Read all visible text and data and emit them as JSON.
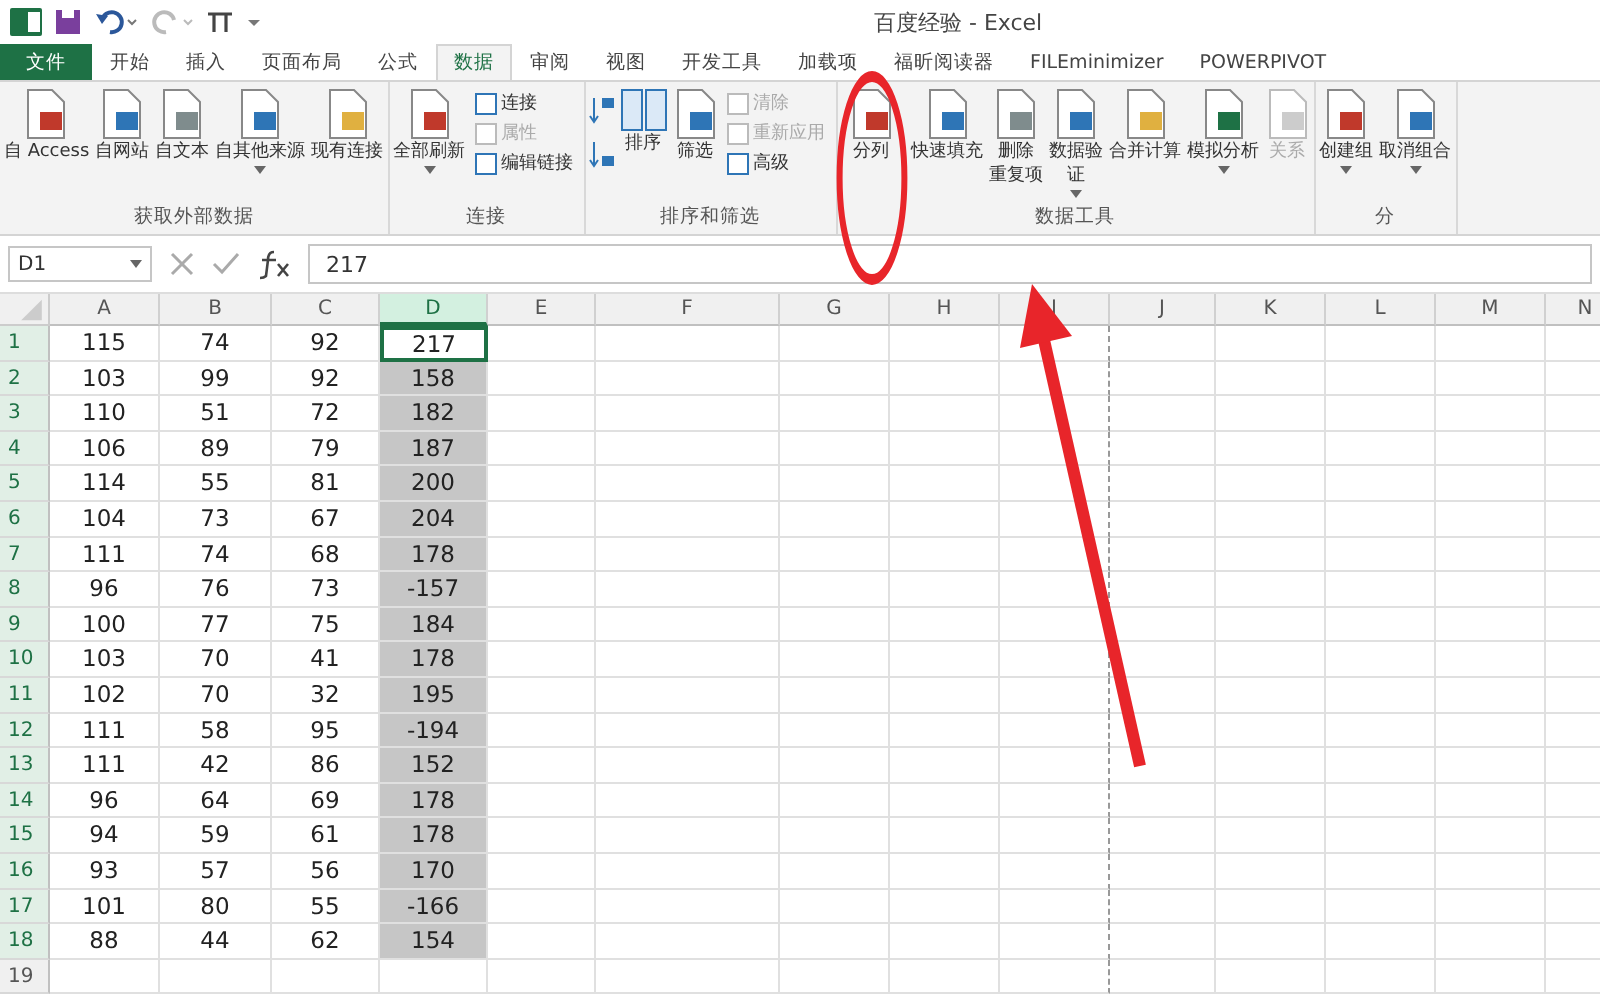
{
  "window": {
    "title": "百度经验 - Excel"
  },
  "tabs": [
    {
      "label": "文件",
      "kind": "file",
      "selected": false
    },
    {
      "label": "开始",
      "kind": "tab",
      "selected": false
    },
    {
      "label": "插入",
      "kind": "tab",
      "selected": false
    },
    {
      "label": "页面布局",
      "kind": "tab",
      "selected": false
    },
    {
      "label": "公式",
      "kind": "tab",
      "selected": false
    },
    {
      "label": "数据",
      "kind": "tab",
      "selected": true
    },
    {
      "label": "审阅",
      "kind": "tab",
      "selected": false
    },
    {
      "label": "视图",
      "kind": "tab",
      "selected": false
    },
    {
      "label": "开发工具",
      "kind": "tab",
      "selected": false
    },
    {
      "label": "加载项",
      "kind": "tab",
      "selected": false
    },
    {
      "label": "福昕阅读器",
      "kind": "tab",
      "selected": false
    },
    {
      "label": "FILEminimizer",
      "kind": "tab",
      "selected": false
    },
    {
      "label": "POWERPIVOT",
      "kind": "tab",
      "selected": false
    }
  ],
  "ribbon_groups": [
    {
      "label": "获取外部数据",
      "buttons": [
        {
          "label": "自 Access",
          "kind": "large",
          "disabled": false,
          "caret": false
        },
        {
          "label": "自网站",
          "kind": "large",
          "disabled": false,
          "caret": false
        },
        {
          "label": "自文本",
          "kind": "large",
          "disabled": false,
          "caret": false
        },
        {
          "label": "自其他来源",
          "kind": "large",
          "disabled": false,
          "caret": true
        },
        {
          "label": "现有连接",
          "kind": "large",
          "disabled": false,
          "caret": false
        }
      ]
    },
    {
      "label": "连接",
      "buttons": [
        {
          "label": "全部刷新",
          "kind": "large",
          "disabled": false,
          "caret": true
        },
        {
          "label": "连接",
          "kind": "small",
          "disabled": false,
          "caret": false
        },
        {
          "label": "属性",
          "kind": "small",
          "disabled": true,
          "caret": false
        },
        {
          "label": "编辑链接",
          "kind": "small",
          "disabled": false,
          "caret": false
        }
      ]
    },
    {
      "label": "排序和筛选",
      "buttons": [
        {
          "label": "排序",
          "kind": "sort",
          "disabled": false,
          "caret": false
        },
        {
          "label": "筛选",
          "kind": "large",
          "disabled": false,
          "caret": false
        },
        {
          "label": "清除",
          "kind": "small",
          "disabled": true,
          "caret": false
        },
        {
          "label": "重新应用",
          "kind": "small",
          "disabled": true,
          "caret": false
        },
        {
          "label": "高级",
          "kind": "small",
          "disabled": false,
          "caret": false
        }
      ]
    },
    {
      "label": "数据工具",
      "buttons": [
        {
          "label": "分列",
          "kind": "large",
          "disabled": false,
          "caret": false,
          "circled": true
        },
        {
          "label": "快速填充",
          "kind": "large",
          "disabled": false,
          "caret": false
        },
        {
          "label": [
            "删除",
            "重复项"
          ],
          "kind": "large",
          "disabled": false,
          "caret": false
        },
        {
          "label": [
            "数据验",
            "证"
          ],
          "kind": "large",
          "disabled": false,
          "caret": true
        },
        {
          "label": "合并计算",
          "kind": "large",
          "disabled": false,
          "caret": false
        },
        {
          "label": "模拟分析",
          "kind": "large",
          "disabled": false,
          "caret": true
        },
        {
          "label": "关系",
          "kind": "large",
          "disabled": true,
          "caret": false
        }
      ]
    },
    {
      "label": "分",
      "buttons": [
        {
          "label": "创建组",
          "kind": "large",
          "disabled": false,
          "caret": true
        },
        {
          "label": "取消组合",
          "kind": "large",
          "disabled": false,
          "caret": true
        }
      ]
    }
  ],
  "formula_bar": {
    "name_box": "D1",
    "formula": "217"
  },
  "columns": [
    {
      "label": "A",
      "selected": false
    },
    {
      "label": "B",
      "selected": false
    },
    {
      "label": "C",
      "selected": false
    },
    {
      "label": "D",
      "selected": true
    },
    {
      "label": "E",
      "selected": false
    },
    {
      "label": "F",
      "selected": false
    },
    {
      "label": "G",
      "selected": false
    },
    {
      "label": "H",
      "selected": false
    },
    {
      "label": "I",
      "selected": false
    },
    {
      "label": "J",
      "selected": false
    },
    {
      "label": "K",
      "selected": false
    },
    {
      "label": "L",
      "selected": false
    },
    {
      "label": "M",
      "selected": false
    },
    {
      "label": "N",
      "selected": false
    }
  ],
  "rows": [
    {
      "header": "1",
      "selected": true,
      "cells": [
        "115",
        "74",
        "92",
        "217"
      ]
    },
    {
      "header": "2",
      "selected": true,
      "cells": [
        "103",
        "99",
        "92",
        "158"
      ]
    },
    {
      "header": "3",
      "selected": true,
      "cells": [
        "110",
        "51",
        "72",
        "182"
      ]
    },
    {
      "header": "4",
      "selected": true,
      "cells": [
        "106",
        "89",
        "79",
        "187"
      ]
    },
    {
      "header": "5",
      "selected": true,
      "cells": [
        "114",
        "55",
        "81",
        "200"
      ]
    },
    {
      "header": "6",
      "selected": true,
      "cells": [
        "104",
        "73",
        "67",
        "204"
      ]
    },
    {
      "header": "7",
      "selected": true,
      "cells": [
        "111",
        "74",
        "68",
        "178"
      ]
    },
    {
      "header": "8",
      "selected": true,
      "cells": [
        "96",
        "76",
        "73",
        "-157"
      ]
    },
    {
      "header": "9",
      "selected": true,
      "cells": [
        "100",
        "77",
        "75",
        "184"
      ]
    },
    {
      "header": "10",
      "selected": true,
      "cells": [
        "103",
        "70",
        "41",
        "178"
      ]
    },
    {
      "header": "11",
      "selected": true,
      "cells": [
        "102",
        "70",
        "32",
        "195"
      ]
    },
    {
      "header": "12",
      "selected": true,
      "cells": [
        "111",
        "58",
        "95",
        "-194"
      ]
    },
    {
      "header": "13",
      "selected": true,
      "cells": [
        "111",
        "42",
        "86",
        "152"
      ]
    },
    {
      "header": "14",
      "selected": true,
      "cells": [
        "96",
        "64",
        "69",
        "178"
      ]
    },
    {
      "header": "15",
      "selected": true,
      "cells": [
        "94",
        "59",
        "61",
        "178"
      ]
    },
    {
      "header": "16",
      "selected": true,
      "cells": [
        "93",
        "57",
        "56",
        "170"
      ]
    },
    {
      "header": "17",
      "selected": true,
      "cells": [
        "101",
        "80",
        "55",
        "-166"
      ]
    },
    {
      "header": "18",
      "selected": true,
      "cells": [
        "88",
        "44",
        "62",
        "154"
      ]
    },
    {
      "header": "19",
      "selected": false,
      "cells": []
    }
  ]
}
